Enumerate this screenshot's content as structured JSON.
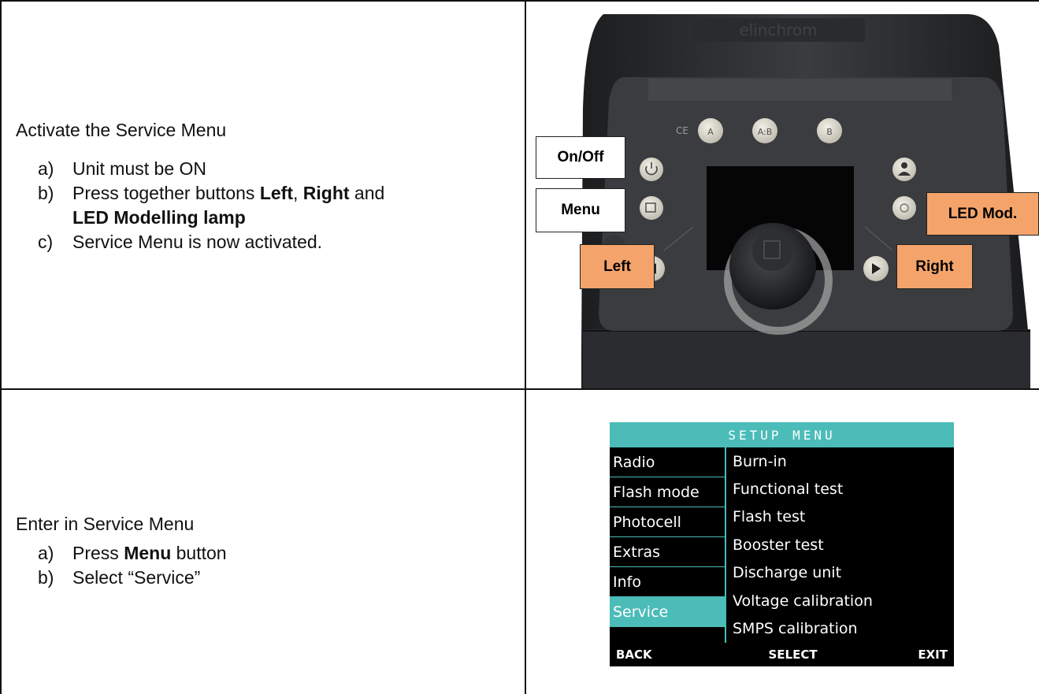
{
  "step1": {
    "heading": "Activate the Service Menu",
    "items": [
      {
        "label": "a)",
        "parts": [
          {
            "text": "Unit must be ON",
            "bold": false
          }
        ]
      },
      {
        "label": "b)",
        "parts": [
          {
            "text": "Press together buttons ",
            "bold": false
          },
          {
            "text": "Left",
            "bold": true
          },
          {
            "text": ", ",
            "bold": false
          },
          {
            "text": "Right",
            "bold": true
          },
          {
            "text": " and",
            "bold": false
          },
          {
            "text": "LED Modelling lamp",
            "bold": true,
            "newline": true
          }
        ]
      },
      {
        "label": "c)",
        "parts": [
          {
            "text": "Service Menu is now activated.",
            "bold": false
          }
        ]
      }
    ]
  },
  "device_photo": {
    "labels": {
      "onoff": "On/Off",
      "menu": "Menu",
      "left": "Left",
      "right": "Right",
      "led": "LED Mod."
    },
    "buttons": {
      "a": "A",
      "ab": "A:B",
      "b": "B"
    },
    "ce_mark": "CE",
    "brand": "elinchrom"
  },
  "step2": {
    "heading": "Enter in Service Menu",
    "items": [
      {
        "label": "a)",
        "parts": [
          {
            "text": "Press ",
            "bold": false
          },
          {
            "text": "Menu",
            "bold": true
          },
          {
            "text": " button",
            "bold": false
          }
        ]
      },
      {
        "label": "b)",
        "parts": [
          {
            "text": "Select “Service”",
            "bold": false
          }
        ]
      }
    ]
  },
  "setup_menu": {
    "title": "SETUP MENU",
    "categories": [
      "Radio",
      "Flash mode",
      "Photocell",
      "Extras",
      "Info",
      "Service"
    ],
    "selected": "Service",
    "options": [
      "Burn-in",
      "Functional test",
      "Flash test",
      "Booster test",
      "Discharge unit",
      "Voltage calibration",
      "SMPS calibration"
    ],
    "footer": {
      "back": "BACK",
      "select": "SELECT",
      "exit": "EXIT"
    }
  },
  "colors": {
    "accent_teal": "#4bbcb8",
    "label_orange": "#f4a46b"
  }
}
